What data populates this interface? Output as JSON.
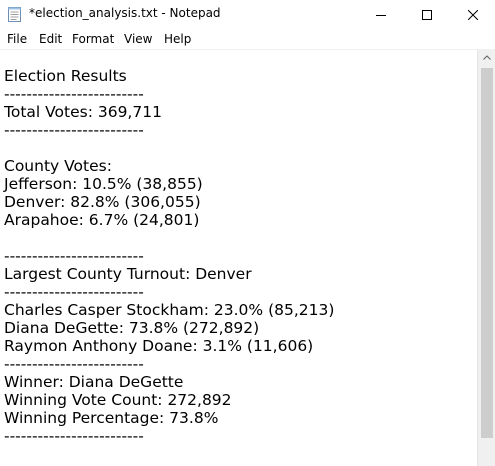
{
  "window": {
    "title": "*election_analysis.txt - Notepad",
    "icon": "notepad-icon"
  },
  "controls": {
    "minimize": "minimize-icon",
    "maximize": "maximize-icon",
    "close": "close-icon"
  },
  "menu": {
    "file": "File",
    "edit": "Edit",
    "format": "Format",
    "view": "View",
    "help": "Help"
  },
  "document": {
    "text": "Election Results\n-------------------------\nTotal Votes: 369,711\n-------------------------\n\nCounty Votes:\nJefferson: 10.5% (38,855)\nDenver: 82.8% (306,055)\nArapahoe: 6.7% (24,801)\n\n-------------------------\nLargest County Turnout: Denver\n-------------------------\nCharles Casper Stockham: 23.0% (85,213)\nDiana DeGette: 73.8% (272,892)\nRaymon Anthony Doane: 3.1% (11,606)\n-------------------------\nWinner: Diana DeGette\nWinning Vote Count: 272,892\nWinning Percentage: 73.8%\n-------------------------"
  }
}
